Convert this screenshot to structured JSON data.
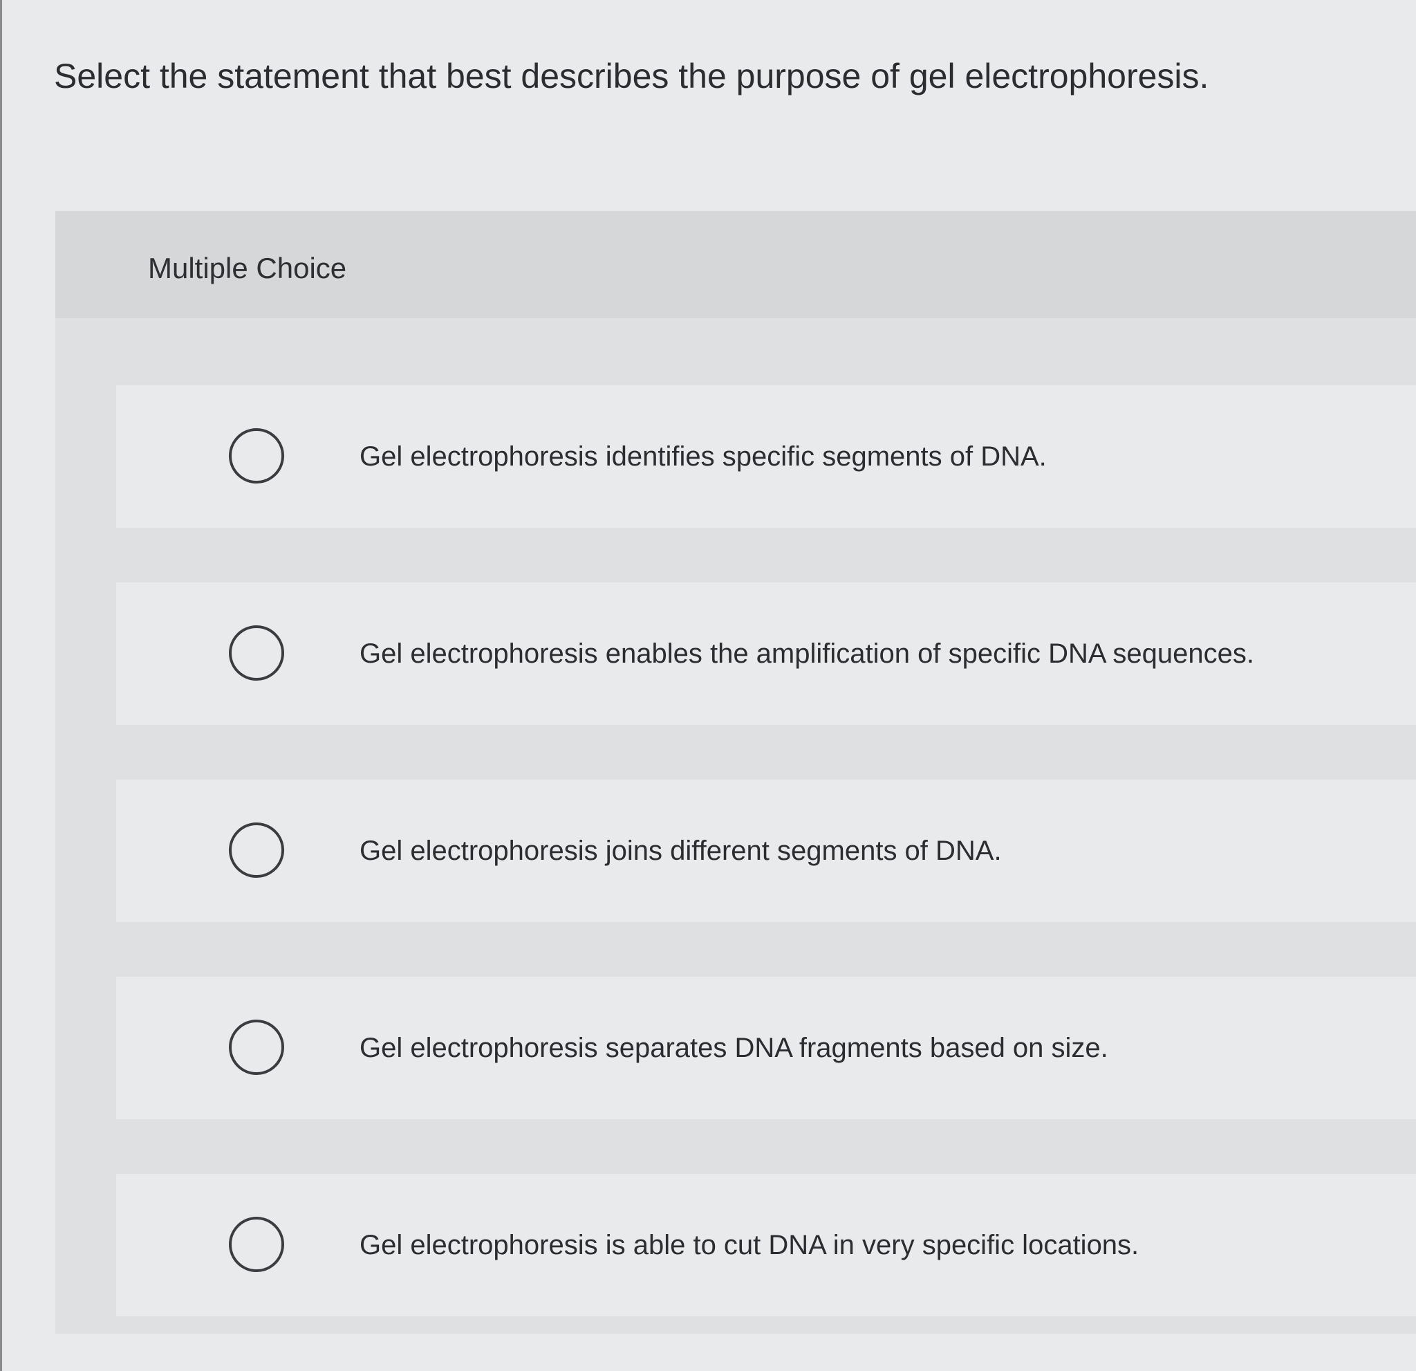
{
  "question": {
    "text": "Select the statement that best describes the purpose of gel electrophoresis."
  },
  "question_type": {
    "label": "Multiple Choice"
  },
  "options": [
    {
      "text": "Gel electrophoresis identifies specific segments of DNA.",
      "selected": false
    },
    {
      "text": "Gel electrophoresis enables the amplification of specific DNA sequences.",
      "selected": false
    },
    {
      "text": "Gel electrophoresis joins different segments of DNA.",
      "selected": false
    },
    {
      "text": "Gel electrophoresis separates DNA fragments based on size.",
      "selected": false
    },
    {
      "text": "Gel electrophoresis is able to cut DNA in very specific locations.",
      "selected": false
    }
  ],
  "colors": {
    "page_background": "#e9eaec",
    "panel_background": "#dfe0e2",
    "option_background": "#e9eaec",
    "text": "#2c2d30",
    "radio_border": "#3b3c3f"
  }
}
